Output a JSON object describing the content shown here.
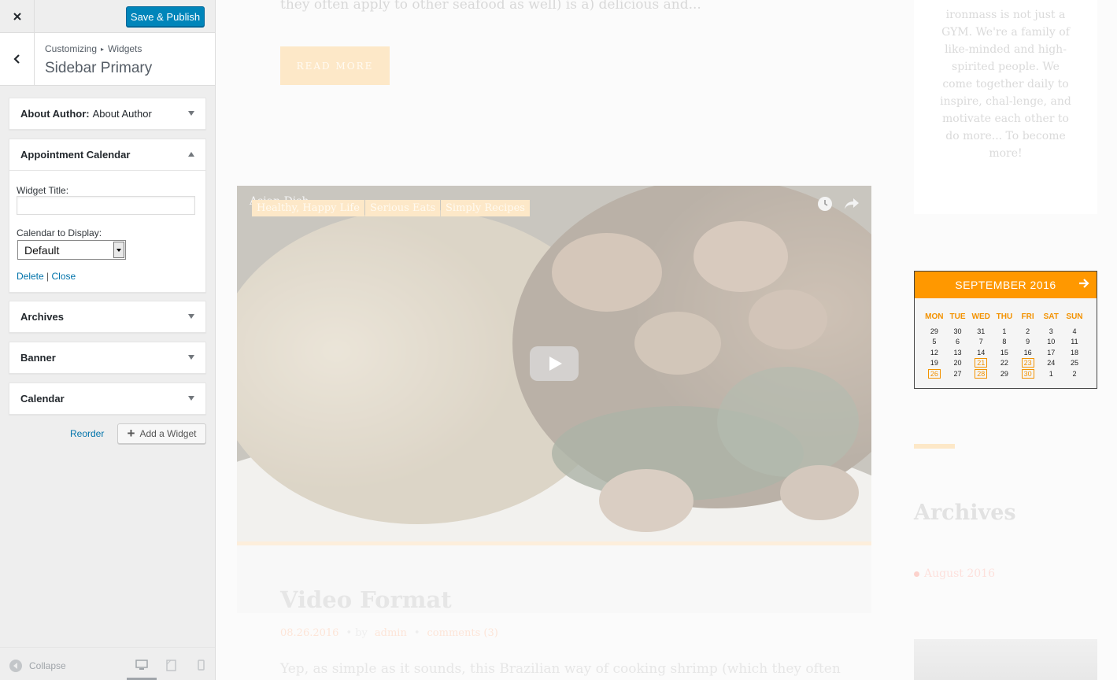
{
  "customizer": {
    "save_label": "Save & Publish",
    "breadcrumb": {
      "first": "Customizing",
      "second": "Widgets"
    },
    "section_title": "Sidebar Primary",
    "widgets": {
      "about_author": {
        "title": "About Author:",
        "subtitle": "About Author"
      },
      "appointment_calendar": {
        "title": "Appointment Calendar",
        "widget_title_label": "Widget Title:",
        "widget_title_value": "",
        "calendar_label": "Calendar to Display:",
        "calendar_value": "Default",
        "delete_label": "Delete",
        "link_separator": "|",
        "close_label": "Close"
      },
      "archives": {
        "title": "Archives"
      },
      "banner": {
        "title": "Banner"
      },
      "calendar": {
        "title": "Calendar"
      }
    },
    "reorder_label": "Reorder",
    "add_widget_label": "Add a Widget",
    "collapse_label": "Collapse"
  },
  "preview": {
    "excerpt_top": "they often apply to other seafood as well) is a) delicious and...",
    "read_more": "READ MORE",
    "video": {
      "title": "Asian Dish",
      "tags": [
        "Healthy, Happy Life",
        "Serious Eats",
        "Simply Recipes"
      ]
    },
    "post": {
      "title": "Video Format",
      "date": "08.26.2016",
      "by": "• by",
      "author": "admin",
      "bullet": "•",
      "comments": "comments (3)",
      "excerpt": "Yep, as simple as it sounds, this Brazilian way of cooking shrimp (which they often"
    },
    "sidebar": {
      "about_text": "ironmass is not just a GYM. We're a family of like-minded and high-spirited people. We come together daily to inspire, chal-lenge, and motivate each other to do more... To become more!",
      "calendar": {
        "month": "SEPTEMBER 2016",
        "days_of_week": [
          "MON",
          "TUE",
          "WED",
          "THU",
          "FRI",
          "SAT",
          "SUN"
        ],
        "weeks": [
          [
            "29",
            "30",
            "31",
            "1",
            "2",
            "3",
            "4"
          ],
          [
            "5",
            "6",
            "7",
            "8",
            "9",
            "10",
            "11"
          ],
          [
            "12",
            "13",
            "14",
            "15",
            "16",
            "17",
            "18"
          ],
          [
            "19",
            "20",
            "21",
            "22",
            "23",
            "24",
            "25"
          ],
          [
            "26",
            "27",
            "28",
            "29",
            "30",
            "1",
            "2"
          ]
        ],
        "highlighted": [
          "21",
          "23",
          "26",
          "28",
          "30"
        ]
      },
      "archives_title": "Archives",
      "archive_items": [
        "August 2016"
      ]
    }
  },
  "colors": {
    "wp_blue": "#0085ba",
    "accent_orange": "#ff9800",
    "panel_bg": "#eeeeee"
  }
}
